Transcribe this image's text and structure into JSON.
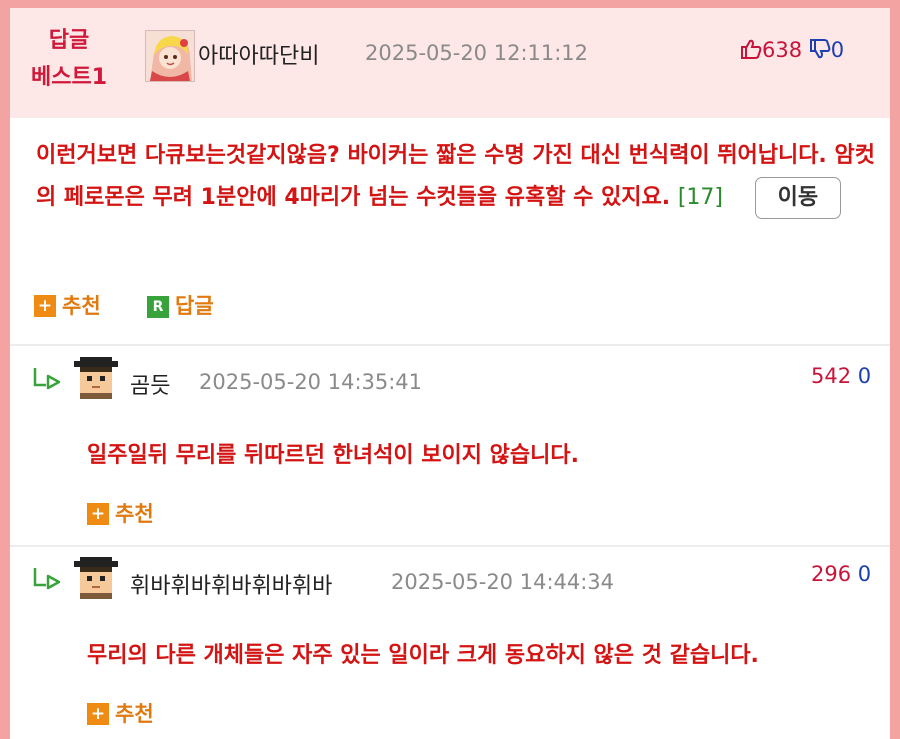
{
  "best_comment": {
    "badge_line1": "답글",
    "badge_line2": "베스트1",
    "nickname": "아따아따단비",
    "datetime": "2025-05-20 12:11:12",
    "upvotes": "638",
    "downvotes": "0",
    "text": "이런거보면 다큐보는것같지않음? 바이커는 짧은 수명 가진 대신 번식력이 뛰어납니다. 암컷의 페로몬은 무려 1분안에 4마리가 넘는 수컷들을 유혹할 수 있지요.",
    "reply_count": "[17]",
    "move_label": "이동",
    "recommend_label": "추천",
    "reply_label": "답글"
  },
  "replies": [
    {
      "nickname": "곰듯",
      "datetime": "2025-05-20 14:35:41",
      "upvotes": "542",
      "downvotes": "0",
      "text": "일주일뒤 무리를 뒤따르던 한녀석이 보이지 않습니다.",
      "recommend_label": "추천"
    },
    {
      "nickname": "휘바휘바휘바휘바휘바",
      "datetime": "2025-05-20 14:44:34",
      "upvotes": "296",
      "downvotes": "0",
      "text": "무리의 다른 개체들은 자주 있는 일이라 크게 동요하지 않은 것 같습니다.",
      "recommend_label": "추천"
    }
  ],
  "icons": {
    "plus": "+",
    "reply_mark": "R"
  },
  "colors": {
    "accent_red": "#d41313",
    "badge_red": "#d0193a",
    "up_red": "#c8143a",
    "down_blue": "#1d3fb0",
    "recommend_orange": "#ef8a12",
    "reply_green": "#37a33a",
    "border_pink": "#f4a3a3"
  }
}
